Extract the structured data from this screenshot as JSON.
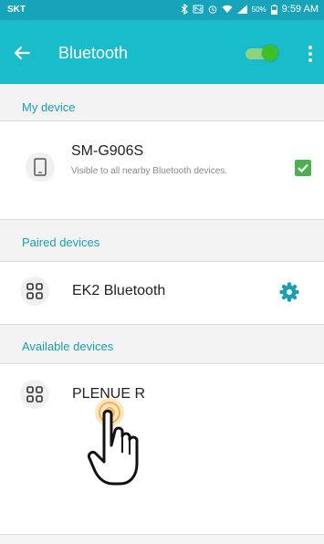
{
  "status_bar": {
    "carrier": "SKT",
    "battery_percent": "50%",
    "time": "9:59 AM"
  },
  "action_bar": {
    "title": "Bluetooth",
    "bluetooth_enabled": true
  },
  "sections": {
    "my_device": "My device",
    "paired_devices": "Paired devices",
    "available_devices": "Available devices"
  },
  "my_device": {
    "name": "SM-G906S",
    "subtitle": "Visible to all nearby Bluetooth devices.",
    "visible_checked": true
  },
  "paired": [
    {
      "name": "EK2 Bluetooth"
    }
  ],
  "available": [
    {
      "name": "PLENUE R"
    }
  ],
  "colors": {
    "status_bar": "#17a3b9",
    "action_bar": "#19bccb",
    "accent": "#1a9fb0",
    "toggle_on": "#3cbf2a",
    "checkbox": "#4caf50"
  }
}
